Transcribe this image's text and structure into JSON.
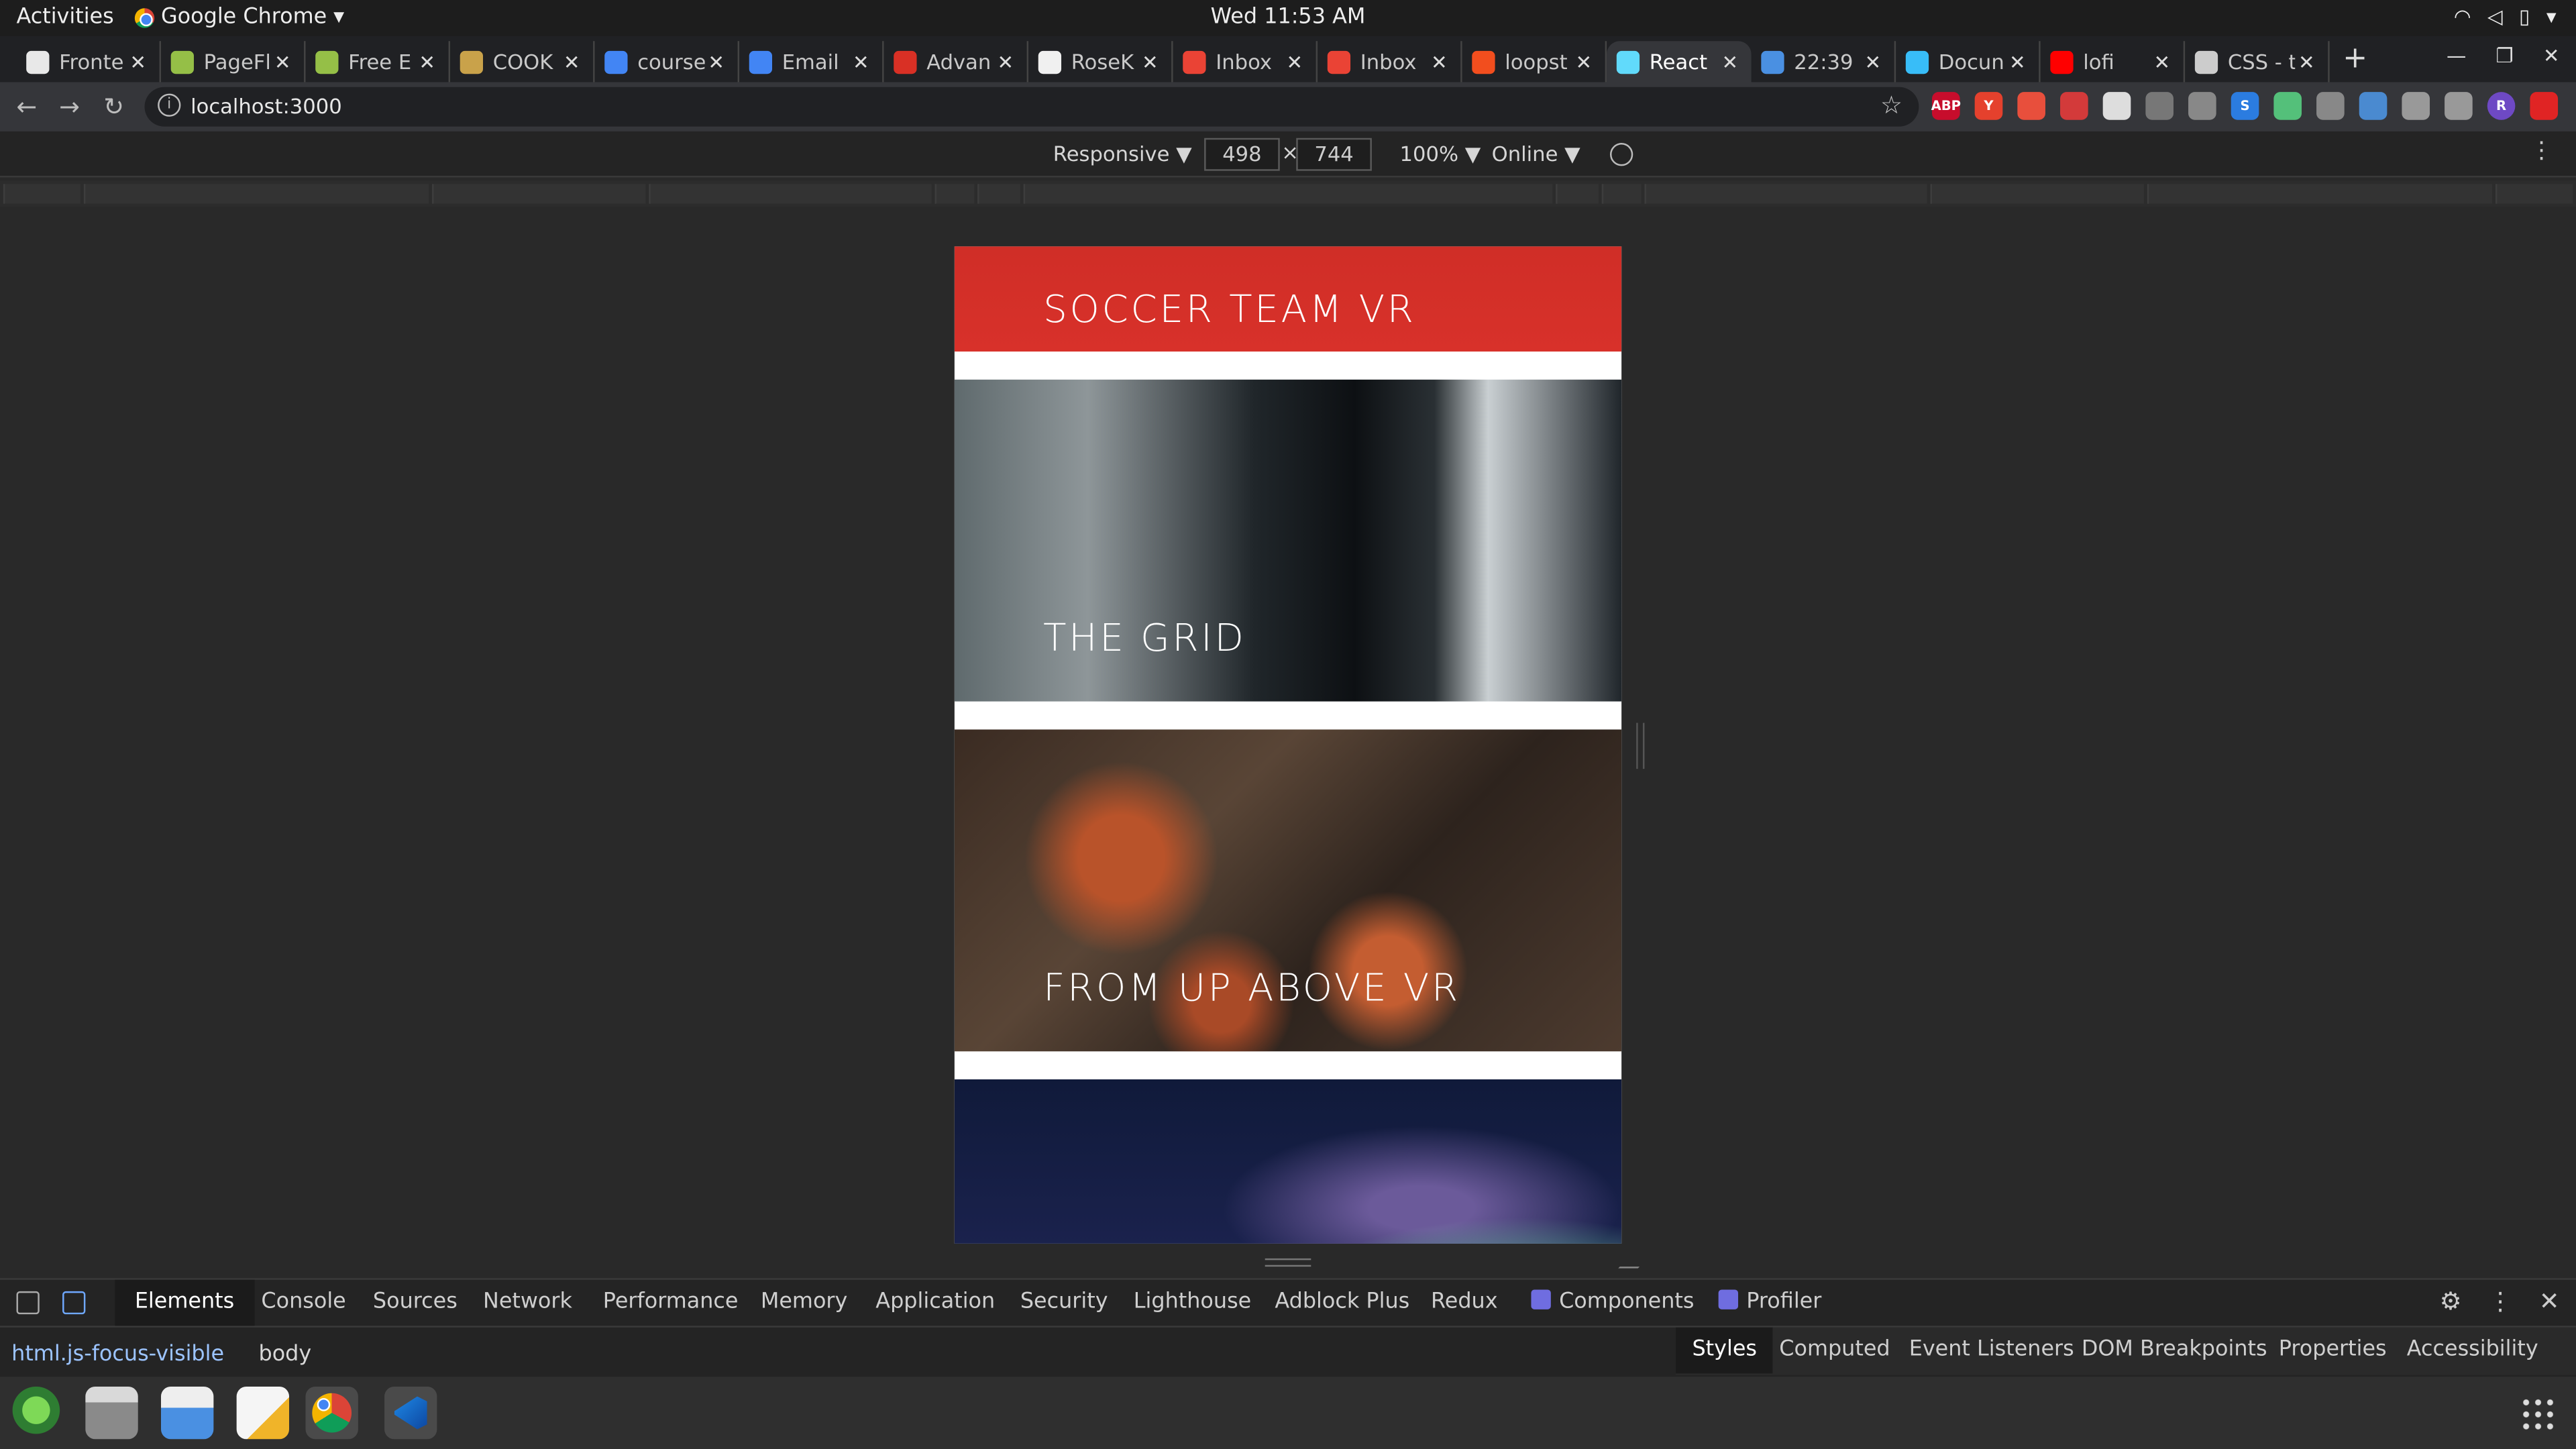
{
  "topbar": {
    "activities": "Activities",
    "app_name": "Google Chrome",
    "clock": "Wed 11:53 AM"
  },
  "tabs": [
    {
      "title": "Fronte",
      "color": "#e8e8e8"
    },
    {
      "title": "PageFl",
      "color": "#95bf47"
    },
    {
      "title": "Free E",
      "color": "#95bf47"
    },
    {
      "title": "COOK",
      "color": "#c9a24a"
    },
    {
      "title": "course",
      "color": "#4285f4"
    },
    {
      "title": "Email",
      "color": "#4285f4"
    },
    {
      "title": "Advan",
      "color": "#d93025"
    },
    {
      "title": "RoseK",
      "color": "#f0f0f0"
    },
    {
      "title": "Inbox",
      "color": "#ea4335"
    },
    {
      "title": "Inbox",
      "color": "#ea4335"
    },
    {
      "title": "loopst",
      "color": "#f24e1e"
    },
    {
      "title": "React",
      "color": "#61dafb"
    },
    {
      "title": "22:39",
      "color": "#4a90e2"
    },
    {
      "title": "Docun",
      "color": "#38bdf8"
    },
    {
      "title": "lofi",
      "color": "#ff0000"
    },
    {
      "title": "CSS - t",
      "color": "#cccccc"
    }
  ],
  "address_bar": {
    "url": "localhost:3000"
  },
  "device_toolbar": {
    "mode": "Responsive ▼",
    "width": "498",
    "times": "×",
    "height": "744",
    "zoom": "100% ▼",
    "network": "Online ▼"
  },
  "page": {
    "cards": [
      {
        "caption": "SOCCER TEAM VR"
      },
      {
        "caption": "THE GRID"
      },
      {
        "caption": "FROM UP ABOVE VR"
      },
      {
        "caption": ""
      }
    ]
  },
  "devtools": {
    "tabs": [
      "Elements",
      "Console",
      "Sources",
      "Network",
      "Performance",
      "Memory",
      "Application",
      "Security",
      "Lighthouse",
      "Adblock Plus",
      "Redux",
      "Components",
      "Profiler"
    ],
    "breadcrumbs": [
      "html.js-focus-visible",
      "body"
    ],
    "styles_tabs": [
      "Styles",
      "Computed",
      "Event Listeners",
      "DOM Breakpoints",
      "Properties",
      "Accessibility"
    ]
  },
  "extensions": [
    {
      "label": "ABP",
      "color": "#c70d2c"
    },
    {
      "label": "Y",
      "color": "#e5412d"
    },
    {
      "label": "",
      "color": "#e84f3c"
    },
    {
      "label": "",
      "color": "#d33a3a"
    },
    {
      "label": "",
      "color": "#dddddd"
    },
    {
      "label": "",
      "color": "#777777"
    },
    {
      "label": "",
      "color": "#888888"
    },
    {
      "label": "S",
      "color": "#2b7ce0"
    },
    {
      "label": "",
      "color": "#54c07a"
    },
    {
      "label": "",
      "color": "#888888"
    },
    {
      "label": "",
      "color": "#4a8ad0"
    },
    {
      "label": "",
      "color": "#999999"
    },
    {
      "label": "",
      "color": "#999999"
    },
    {
      "label": "R",
      "color": "#6e49c4"
    },
    {
      "label": "",
      "color": "#e02424"
    }
  ]
}
